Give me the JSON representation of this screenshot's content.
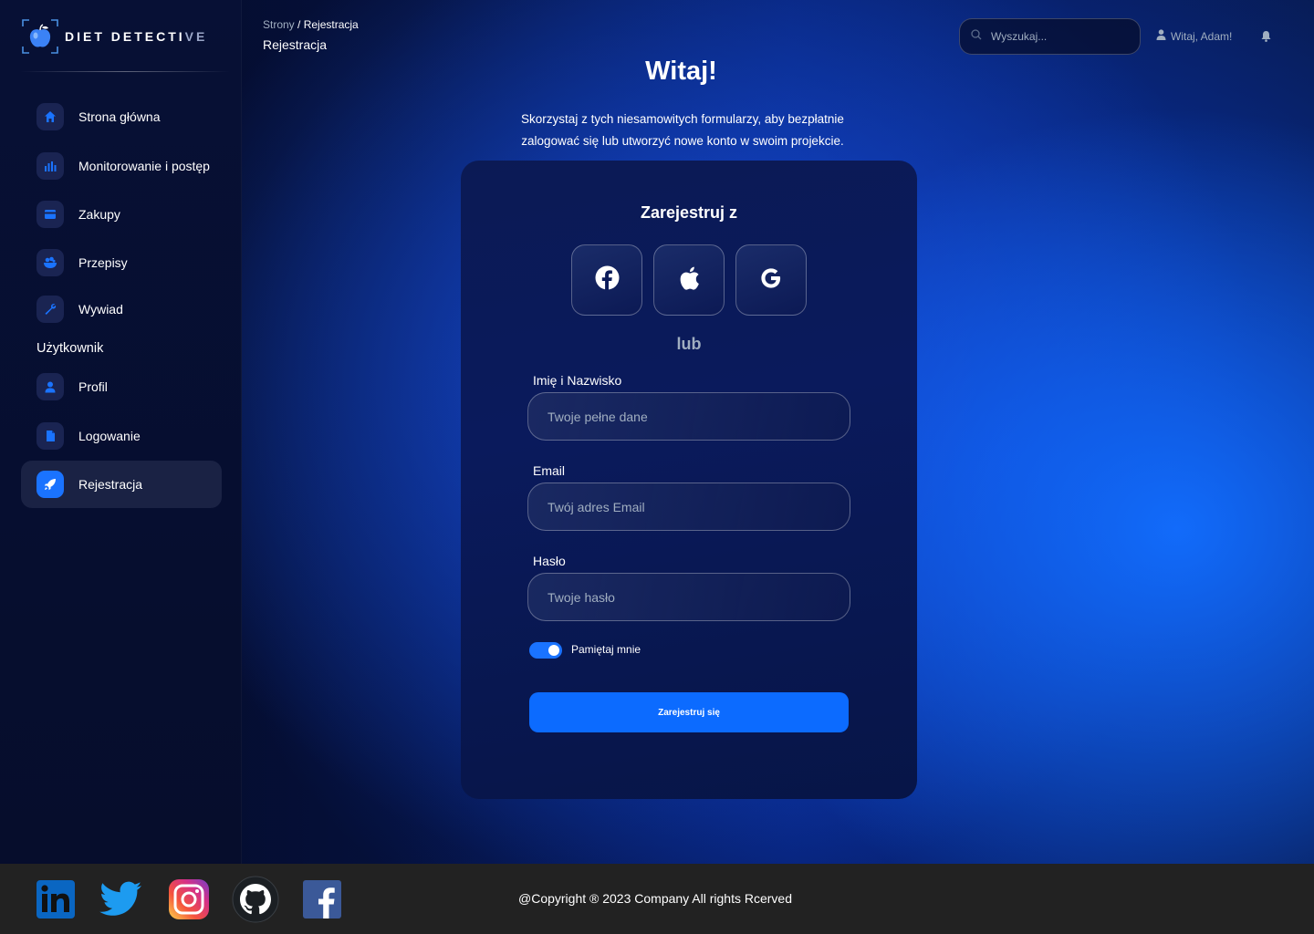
{
  "brand": {
    "name_main": "DIET DETECTI",
    "name_fade": "VE"
  },
  "sidebar": {
    "items": [
      {
        "label": "Strona główna",
        "icon": "home-icon"
      },
      {
        "label": "Monitorowanie i postęp",
        "icon": "chart-icon"
      },
      {
        "label": "Zakupy",
        "icon": "credit-card-icon"
      },
      {
        "label": "Przepisy",
        "icon": "recipes-icon"
      },
      {
        "label": "Wywiad",
        "icon": "wrench-icon"
      }
    ],
    "section_title": "Użytkownik",
    "user_items": [
      {
        "label": "Profil",
        "icon": "person-icon"
      },
      {
        "label": "Logowanie",
        "icon": "document-icon"
      },
      {
        "label": "Rejestracja",
        "icon": "rocket-icon",
        "active": true
      }
    ]
  },
  "header": {
    "breadcrumb_root": "Strony",
    "breadcrumb_sep": " / ",
    "breadcrumb_current": "Rejestracja",
    "page_title": "Rejestracja",
    "search_placeholder": "Wyszukaj...",
    "greeting": "Witaj, Adam!"
  },
  "hero": {
    "title": "Witaj!",
    "subtitle": "Skorzystaj z tych niesamowitych formularzy, aby bezpłatnie zalogować się lub utworzyć nowe konto w swoim projekcie."
  },
  "form": {
    "title": "Zarejestruj z",
    "social": [
      "facebook",
      "apple",
      "google"
    ],
    "or_text": "lub",
    "name_label": "Imię i Nazwisko",
    "name_placeholder": "Twoje pełne dane",
    "email_label": "Email",
    "email_placeholder": "Twój adres Email",
    "password_label": "Hasło",
    "password_placeholder": "Twoje hasło",
    "remember_label": "Pamiętaj mnie",
    "remember_on": true,
    "submit_label": "Zarejestruj się"
  },
  "footer": {
    "social": [
      "linkedin",
      "twitter",
      "instagram",
      "github",
      "facebook"
    ],
    "copyright": "@Copyright ® 2023 Company All rights Rcerved"
  },
  "colors": {
    "accent": "#1a73ff",
    "button": "#0c6bff",
    "muted": "#a0aec0",
    "footer": "#222222"
  }
}
